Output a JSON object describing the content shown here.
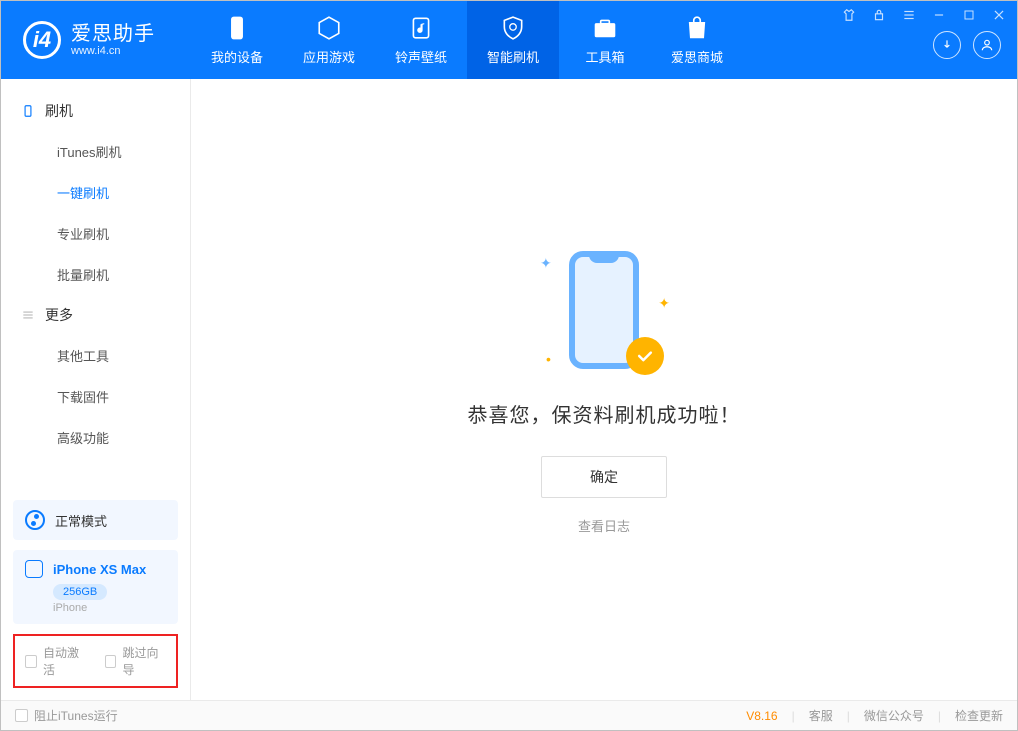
{
  "header": {
    "logo_title": "爱思助手",
    "logo_sub": "www.i4.cn",
    "tabs": [
      {
        "label": "我的设备"
      },
      {
        "label": "应用游戏"
      },
      {
        "label": "铃声壁纸"
      },
      {
        "label": "智能刷机"
      },
      {
        "label": "工具箱"
      },
      {
        "label": "爱思商城"
      }
    ]
  },
  "sidebar": {
    "group1_title": "刷机",
    "items1": [
      {
        "label": "iTunes刷机"
      },
      {
        "label": "一键刷机"
      },
      {
        "label": "专业刷机"
      },
      {
        "label": "批量刷机"
      }
    ],
    "group2_title": "更多",
    "items2": [
      {
        "label": "其他工具"
      },
      {
        "label": "下载固件"
      },
      {
        "label": "高级功能"
      }
    ],
    "mode_label": "正常模式",
    "device_name": "iPhone XS Max",
    "device_storage": "256GB",
    "device_type": "iPhone",
    "auto_activate": "自动激活",
    "skip_wizard": "跳过向导"
  },
  "main": {
    "success_msg": "恭喜您，保资料刷机成功啦！",
    "ok_label": "确定",
    "log_label": "查看日志"
  },
  "footer": {
    "block_itunes": "阻止iTunes运行",
    "version": "V8.16",
    "support": "客服",
    "wechat": "微信公众号",
    "check_update": "检查更新"
  }
}
